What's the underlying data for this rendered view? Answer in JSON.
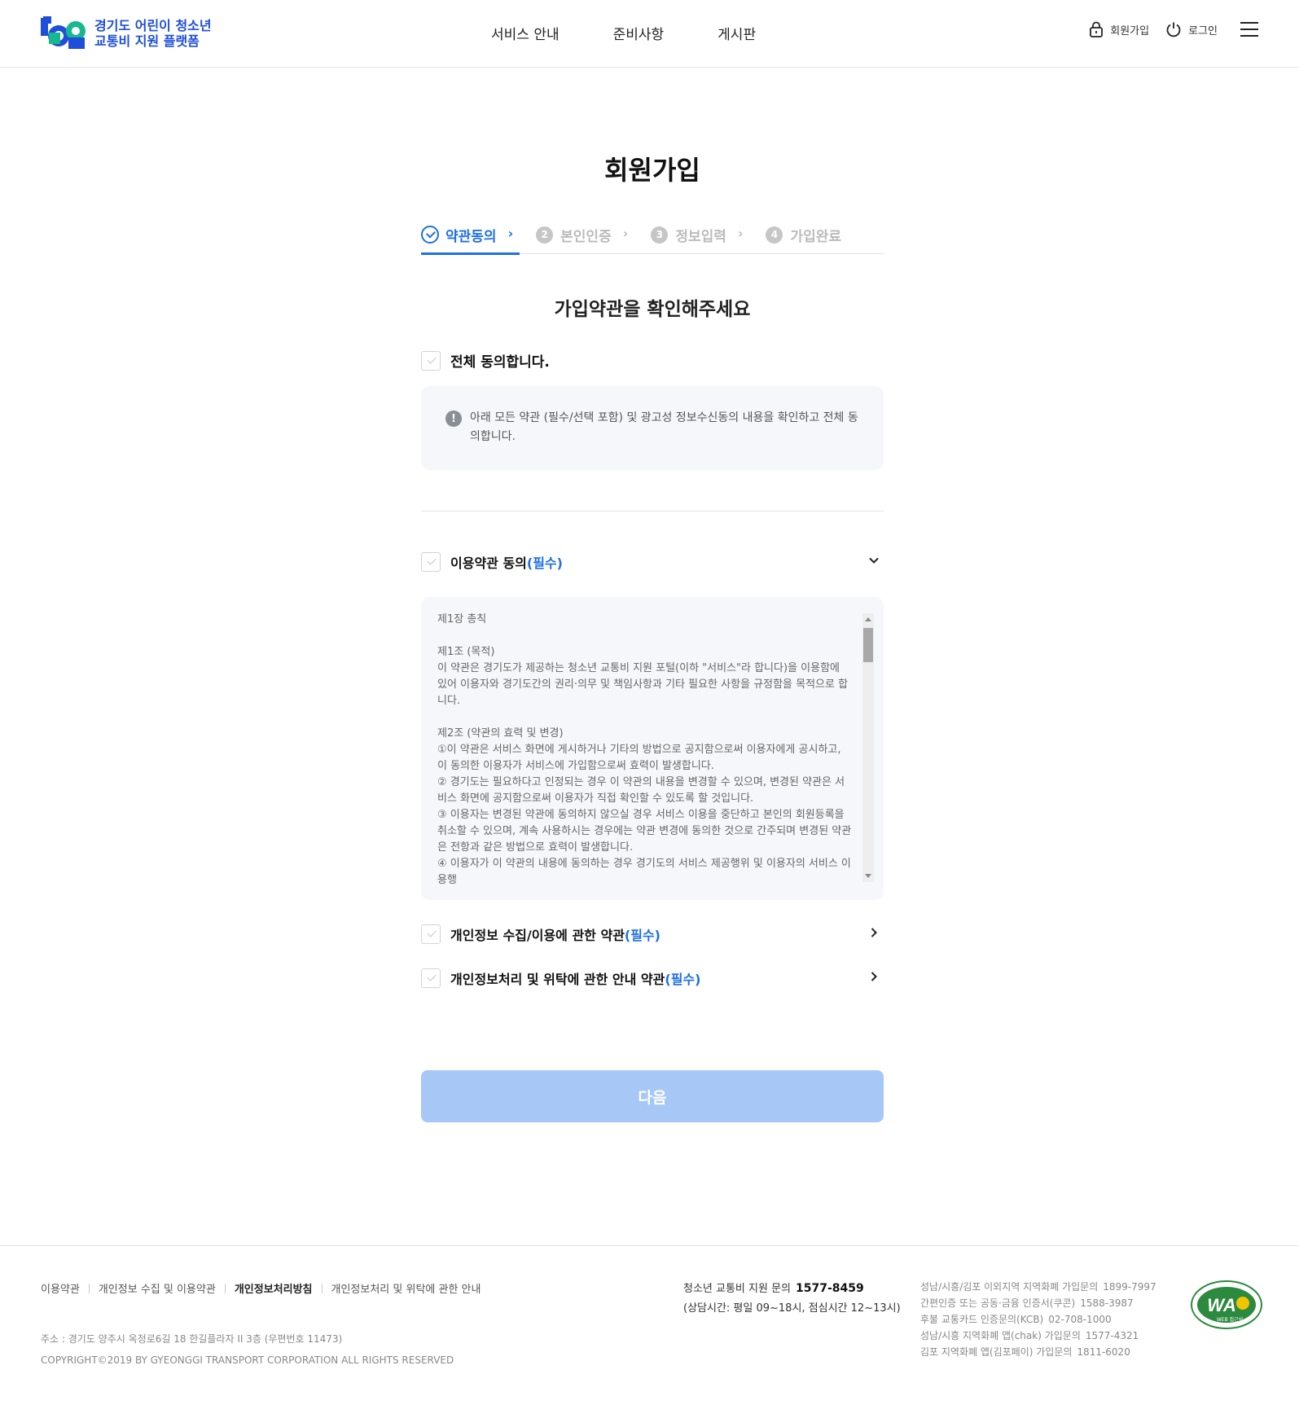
{
  "header": {
    "logo_line1": "경기도 어린이 청소년",
    "logo_line2": "교통비 지원 플랫폼",
    "nav": [
      "서비스 안내",
      "준비사항",
      "게시판"
    ],
    "signup": "회원가입",
    "login": "로그인"
  },
  "page": {
    "title": "회원가입",
    "steps": [
      {
        "label": "약관동의"
      },
      {
        "num": "2",
        "label": "본인인증"
      },
      {
        "num": "3",
        "label": "정보입력"
      },
      {
        "num": "4",
        "label": "가입완료"
      }
    ],
    "subtitle": "가입약관을 확인해주세요",
    "agree_all": "전체 동의합니다.",
    "notice": "아래 모든 약관 (필수/선택 포함) 및 광고성 정보수신동의 내용을 확인하고 전체 동의합니다.",
    "terms": [
      {
        "label": "이용약관 동의",
        "required": "(필수)"
      },
      {
        "label": "개인정보 수집/이용에 관한 약관",
        "required": "(필수)"
      },
      {
        "label": "개인정보처리 및 위탁에 관한 안내 약관",
        "required": "(필수)"
      }
    ],
    "terms_text": "제1장 총칙\n\n제1조 (목적)\n이 약관은 경기도가 제공하는 청소년 교통비 지원 포털(이하 \"서비스\"라 합니다)을 이용함에 있어 이용자와 경기도간의 권리·의무 및 책임사항과 기타 필요한 사항을 규정함을 목적으로 합니다.\n\n제2조 (약관의 효력 및 변경)\n①이 약관은 서비스 화면에 게시하거나 기타의 방법으로 공지함으로써 이용자에게 공시하고, 이 동의한 이용자가 서비스에 가입함으로써 효력이 발생합니다.\n② 경기도는 필요하다고 인정되는 경우 이 약관의 내용을 변경할 수 있으며, 변경된 약관은 서비스 화면에 공지함으로써 이용자가 직접 확인할 수 있도록 할 것입니다.\n③ 이용자는 변경된 약관에 동의하지 않으실 경우 서비스 이용을 중단하고 본인의 회원등록을 취소할 수 있으며, 계속 사용하시는 경우에는 약관 변경에 동의한 것으로 간주되며 변경된 약관은 전항과 같은 방법으로 효력이 발생합니다.\n④ 이용자가 이 약관의 내용에 동의하는 경우 경기도의 서비스 제공행위 및 이용자의 서비스 이용행",
    "next_button": "다음"
  },
  "footer": {
    "links": [
      "이용약관",
      "개인정보 수집 및 이용약관",
      "개인정보처리방침",
      "개인정보처리 및 위탁에 관한 안내"
    ],
    "address": "주소 : 경기도 양주시 옥정로6길 18 한길플라자 II 3층 (우편번호 11473)",
    "copyright": "COPYRIGHT©2019 BY GYEONGGI TRANSPORT CORPORATION ALL RIGHTS RESERVED",
    "contact_label": "청소년 교통비 지원 문의",
    "contact_number": "1577-8459",
    "contact_hours": "(상담시간: 평일 09~18시, 점심시간 12~13시)",
    "local": [
      {
        "label": "성남/시흥/김포 이외지역 지역화폐 가입문의",
        "num": "1899-7997"
      },
      {
        "label": "간편인증 또는 공동·금융 인증서(쿠콘)",
        "num": "1588-3987"
      },
      {
        "label": "후불 교통카드 인증문의(KCB)",
        "num": "02-708-1000"
      },
      {
        "label": "성남/시흥 지역화폐 앱(chak) 가입문의",
        "num": "1577-4321"
      },
      {
        "label": "김포 지역화폐 앱(김포페이) 가입문의",
        "num": "1811-6020"
      }
    ],
    "wa_text": "WA",
    "wa_caption": "WEB 접근성"
  },
  "colors": {
    "accent": "#1f6fe5",
    "button_disabled": "#a7c8f6",
    "logo_blue": "#1f4ed8",
    "logo_green": "#17b890"
  }
}
